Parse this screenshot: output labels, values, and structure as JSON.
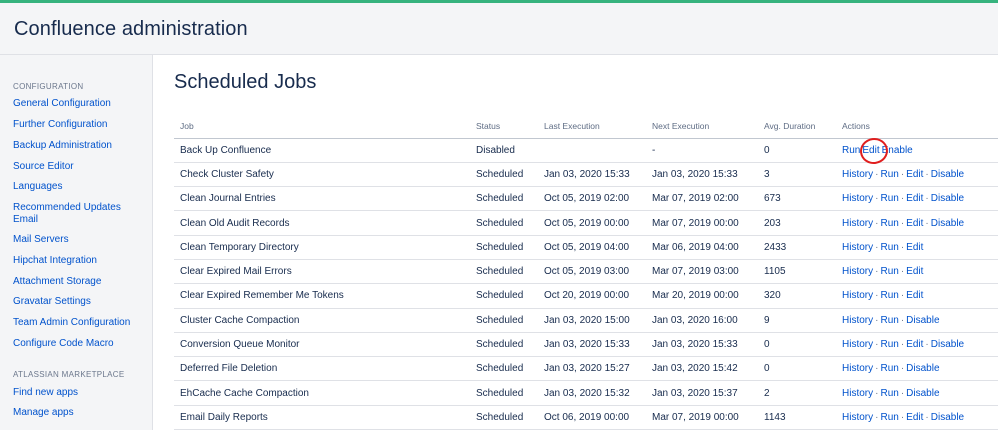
{
  "header": {
    "title": "Confluence administration"
  },
  "sidebar": {
    "configuration_heading": "CONFIGURATION",
    "items": [
      {
        "label": "General Configuration"
      },
      {
        "label": "Further Configuration"
      },
      {
        "label": "Backup Administration"
      },
      {
        "label": "Source Editor"
      },
      {
        "label": "Languages"
      },
      {
        "label": "Recommended Updates Email"
      },
      {
        "label": "Mail Servers"
      },
      {
        "label": "Hipchat Integration"
      },
      {
        "label": "Attachment Storage"
      },
      {
        "label": "Gravatar Settings"
      },
      {
        "label": "Team Admin Configuration"
      },
      {
        "label": "Configure Code Macro"
      }
    ],
    "marketplace_heading": "ATLASSIAN MARKETPLACE",
    "marketplace_items": [
      {
        "label": "Find new apps"
      },
      {
        "label": "Manage apps"
      }
    ]
  },
  "main": {
    "title": "Scheduled Jobs",
    "columns": [
      "Job",
      "Status",
      "Last Execution",
      "Next Execution",
      "Avg. Duration",
      "Actions"
    ],
    "rows": [
      {
        "job": "Back Up Confluence",
        "status": "Disabled",
        "last": "",
        "next": "-",
        "avg": "0",
        "actions": [
          "Run",
          "Edit",
          "Enable"
        ]
      },
      {
        "job": "Check Cluster Safety",
        "status": "Scheduled",
        "last": "Jan 03, 2020 15:33",
        "next": "Jan 03, 2020 15:33",
        "avg": "3",
        "actions": [
          "History",
          "Run",
          "Edit",
          "Disable"
        ]
      },
      {
        "job": "Clean Journal Entries",
        "status": "Scheduled",
        "last": "Oct 05, 2019 02:00",
        "next": "Mar 07, 2019 02:00",
        "avg": "673",
        "actions": [
          "History",
          "Run",
          "Edit",
          "Disable"
        ]
      },
      {
        "job": "Clean Old Audit Records",
        "status": "Scheduled",
        "last": "Oct 05, 2019 00:00",
        "next": "Mar 07, 2019 00:00",
        "avg": "203",
        "actions": [
          "History",
          "Run",
          "Edit",
          "Disable"
        ]
      },
      {
        "job": "Clean Temporary Directory",
        "status": "Scheduled",
        "last": "Oct 05, 2019 04:00",
        "next": "Mar 06, 2019 04:00",
        "avg": "2433",
        "actions": [
          "History",
          "Run",
          "Edit"
        ]
      },
      {
        "job": "Clear Expired Mail Errors",
        "status": "Scheduled",
        "last": "Oct 05, 2019 03:00",
        "next": "Mar 07, 2019 03:00",
        "avg": "1105",
        "actions": [
          "History",
          "Run",
          "Edit"
        ]
      },
      {
        "job": "Clear Expired Remember Me Tokens",
        "status": "Scheduled",
        "last": "Oct 20, 2019 00:00",
        "next": "Mar 20, 2019 00:00",
        "avg": "320",
        "actions": [
          "History",
          "Run",
          "Edit"
        ]
      },
      {
        "job": "Cluster Cache Compaction",
        "status": "Scheduled",
        "last": "Jan 03, 2020 15:00",
        "next": "Jan 03, 2020 16:00",
        "avg": "9",
        "actions": [
          "History",
          "Run",
          "Disable"
        ]
      },
      {
        "job": "Conversion Queue Monitor",
        "status": "Scheduled",
        "last": "Jan 03, 2020 15:33",
        "next": "Jan 03, 2020 15:33",
        "avg": "0",
        "actions": [
          "History",
          "Run",
          "Edit",
          "Disable"
        ]
      },
      {
        "job": "Deferred File Deletion",
        "status": "Scheduled",
        "last": "Jan 03, 2020 15:27",
        "next": "Jan 03, 2020 15:42",
        "avg": "0",
        "actions": [
          "History",
          "Run",
          "Disable"
        ]
      },
      {
        "job": "EhCache Cache Compaction",
        "status": "Scheduled",
        "last": "Jan 03, 2020 15:32",
        "next": "Jan 03, 2020 15:37",
        "avg": "2",
        "actions": [
          "History",
          "Run",
          "Disable"
        ]
      },
      {
        "job": "Email Daily Reports",
        "status": "Scheduled",
        "last": "Oct 06, 2019 00:00",
        "next": "Mar 07, 2019 00:00",
        "avg": "1143",
        "actions": [
          "History",
          "Run",
          "Edit",
          "Disable"
        ]
      }
    ]
  },
  "colors": {
    "accent": "#0052cc",
    "top_stripe": "#36b37e",
    "annotation": "#e01e1e"
  }
}
